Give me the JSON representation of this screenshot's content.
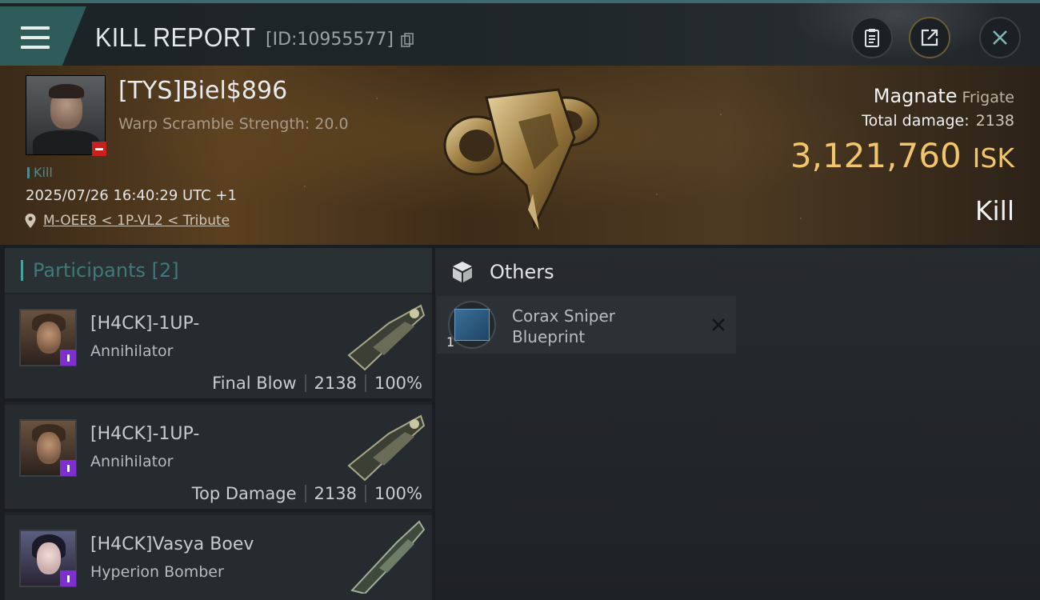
{
  "header": {
    "title": "KILL REPORT",
    "report_id": "[ID:10955577]",
    "buttons": [
      "clipboard-icon",
      "share-icon",
      "close-icon"
    ]
  },
  "victim": {
    "name": "[TYS]Biel$896",
    "warp_scramble": "Warp Scramble Strength: 20.0",
    "tag": "Kill",
    "datetime": "2025/07/26 16:40:29 UTC +1",
    "location": "M-OEE8 < 1P-VL2 < Tribute",
    "ship_name": "Magnate",
    "ship_class": "Frigate",
    "total_damage_label": "Total damage:",
    "total_damage": "2138",
    "isk_value": "3,121,760",
    "isk_unit": "ISK",
    "result": "Kill"
  },
  "participants": {
    "heading": "Participants [2]",
    "rows": [
      {
        "name": "[H4CK]-1UP-",
        "ship": "Annihilator",
        "role": "Final Blow",
        "damage": "2138",
        "percent": "100%"
      },
      {
        "name": "[H4CK]-1UP-",
        "ship": "Annihilator",
        "role": "Top Damage",
        "damage": "2138",
        "percent": "100%"
      },
      {
        "name": "[H4CK]Vasya Boev",
        "ship": "Hyperion Bomber",
        "role": "",
        "damage": "",
        "percent": ""
      }
    ]
  },
  "others": {
    "heading": "Others",
    "items": [
      {
        "name": "Corax Sniper Blueprint",
        "qty": "1"
      }
    ]
  },
  "colors": {
    "accent_teal": "#3f7979",
    "isk_gold": "#f2c46b",
    "badge_red": "#c9201d",
    "badge_purple": "#7e2fd1"
  }
}
